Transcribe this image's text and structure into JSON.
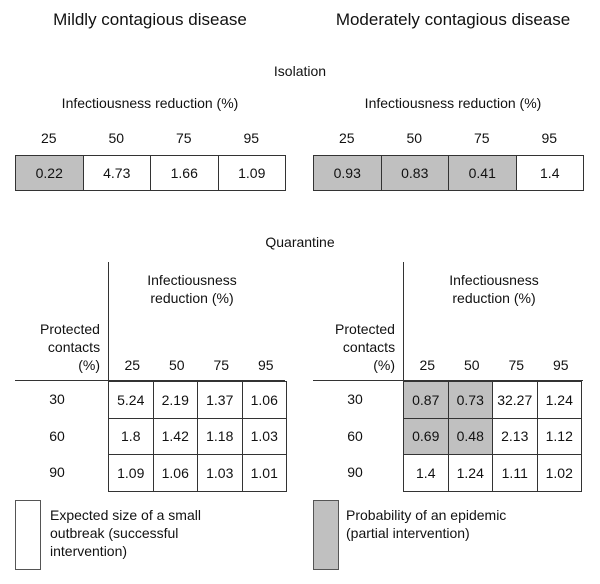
{
  "titles": {
    "left": "Mildly contagious disease",
    "right": "Moderately contagious disease"
  },
  "isolation": {
    "label": "Isolation",
    "axis_label": "Infectiousness reduction (%)",
    "columns": [
      "25",
      "50",
      "75",
      "95"
    ],
    "left": {
      "values": [
        "0.22",
        "4.73",
        "1.66",
        "1.09"
      ],
      "shaded": [
        true,
        false,
        false,
        false
      ]
    },
    "right": {
      "values": [
        "0.93",
        "0.83",
        "0.41",
        "1.4"
      ],
      "shaded": [
        true,
        true,
        true,
        false
      ]
    }
  },
  "quarantine": {
    "label": "Quarantine",
    "axis_label_line1": "Infectiousness",
    "axis_label_line2": "reduction (%)",
    "row_label_line1": "Protected",
    "row_label_line2": "contacts",
    "row_label_line3": "(%)",
    "columns": [
      "25",
      "50",
      "75",
      "95"
    ],
    "rows": [
      "30",
      "60",
      "90"
    ],
    "left": {
      "values": [
        [
          "5.24",
          "2.19",
          "1.37",
          "1.06"
        ],
        [
          "1.8",
          "1.42",
          "1.18",
          "1.03"
        ],
        [
          "1.09",
          "1.06",
          "1.03",
          "1.01"
        ]
      ],
      "shaded": [
        [
          false,
          false,
          false,
          false
        ],
        [
          false,
          false,
          false,
          false
        ],
        [
          false,
          false,
          false,
          false
        ]
      ]
    },
    "right": {
      "values": [
        [
          "0.87",
          "0.73",
          "32.27",
          "1.24"
        ],
        [
          "0.69",
          "0.48",
          "2.13",
          "1.12"
        ],
        [
          "1.4",
          "1.24",
          "1.11",
          "1.02"
        ]
      ],
      "shaded": [
        [
          true,
          true,
          false,
          false
        ],
        [
          true,
          true,
          false,
          false
        ],
        [
          false,
          false,
          false,
          false
        ]
      ]
    }
  },
  "legend": {
    "white": "Expected size of a small\noutbreak (successful\nintervention)",
    "gray": "Probability of an epidemic\n(partial intervention)"
  },
  "colors": {
    "shaded": "#c0c0c0",
    "unshaded": "#ffffff"
  }
}
